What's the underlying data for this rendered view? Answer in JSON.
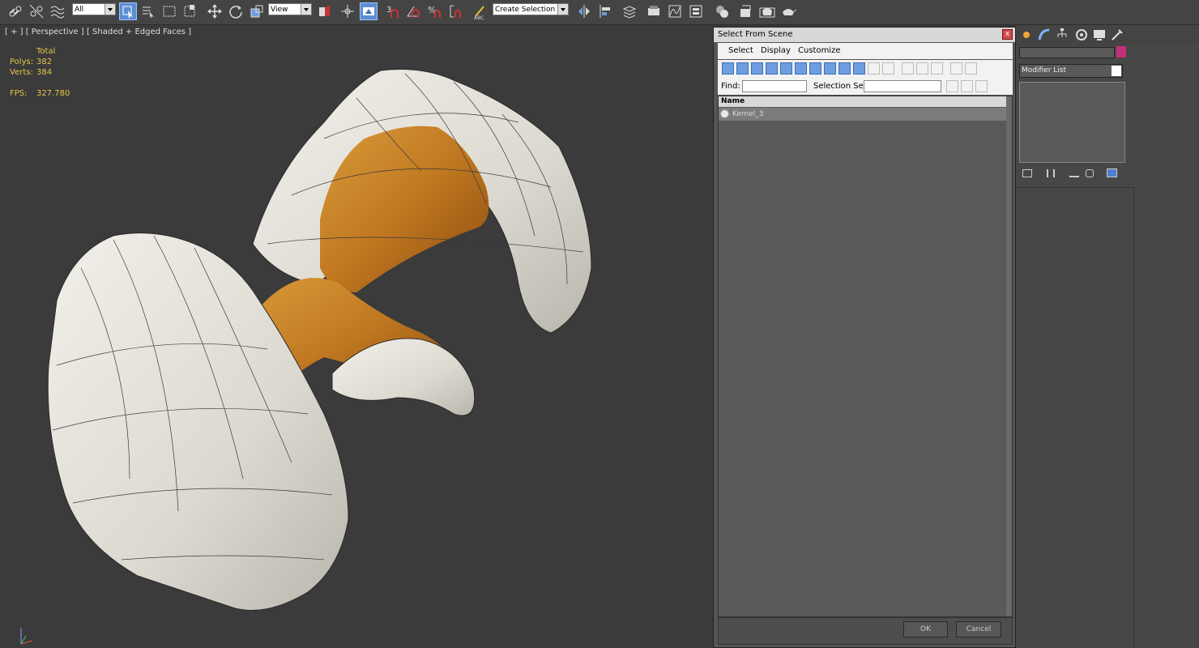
{
  "toolbar": {
    "selection_filter": "All",
    "reference_coordinate": "View",
    "named_selection_placeholder": "Create Selection Se"
  },
  "viewport": {
    "label": "[ + ] [ Perspective ] [ Shaded + Edged Faces ]",
    "stats": {
      "total_label": "Total",
      "polys_label": "Polys:",
      "polys_value": "382",
      "verts_label": "Verts:",
      "verts_value": "384",
      "fps_label": "FPS:",
      "fps_value": "327.780"
    },
    "axis": {
      "x": "x",
      "y": "y",
      "z": "z"
    }
  },
  "dialog": {
    "title": "Select From Scene",
    "close": "x",
    "menu": [
      "Select",
      "Display",
      "Customize"
    ],
    "find_label": "Find:",
    "selection_set_label": "Selection Set:",
    "list_header": "Name",
    "items": [
      "Kernel_3"
    ],
    "ok": "OK",
    "cancel": "Cancel"
  },
  "command_panel": {
    "modifier_list": "Modifier List",
    "accent_color": "#c0307a"
  }
}
